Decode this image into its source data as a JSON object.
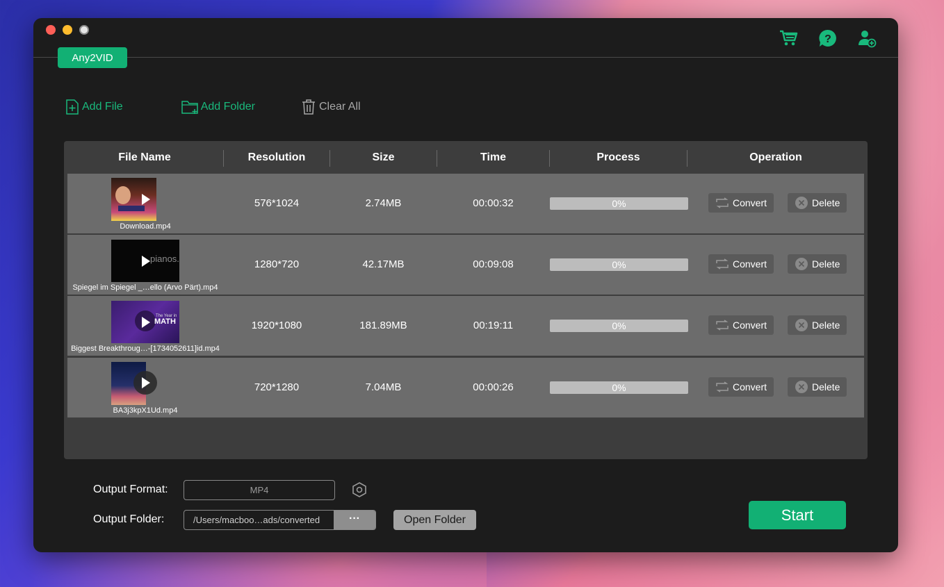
{
  "app": {
    "brand_tab": "Any2VID",
    "accent_color": "#12b074"
  },
  "top_icons": [
    "cart-icon",
    "help-icon",
    "add-user-icon"
  ],
  "toolbar": {
    "add_file": "Add File",
    "add_folder": "Add Folder",
    "clear_all": "Clear All"
  },
  "table": {
    "headers": [
      "File Name",
      "Resolution",
      "Size",
      "Time",
      "Process",
      "Operation"
    ],
    "rows": [
      {
        "filename": "Download.mp4",
        "resolution": "576*1024",
        "size": "2.74MB",
        "time": "00:00:32",
        "process": "0%",
        "convert": "Convert",
        "delete": "Delete"
      },
      {
        "filename": "Spiegel im Spiegel _…ello (Arvo Pärt).mp4",
        "resolution": "1280*720",
        "size": "42.17MB",
        "time": "00:09:08",
        "process": "0%",
        "convert": "Convert",
        "delete": "Delete",
        "thumb_text": "pianos."
      },
      {
        "filename": "Biggest Breakthroug…-[1734052611]id.mp4",
        "resolution": "1920*1080",
        "size": "181.89MB",
        "time": "00:19:11",
        "process": "0%",
        "convert": "Convert",
        "delete": "Delete",
        "thumb_text": "MATH",
        "thumb_small": "The Year in"
      },
      {
        "filename": "BA3j3kpX1Ud.mp4",
        "resolution": "720*1280",
        "size": "7.04MB",
        "time": "00:00:26",
        "process": "0%",
        "convert": "Convert",
        "delete": "Delete"
      }
    ]
  },
  "output": {
    "format_label": "Output Format:",
    "format_value": "MP4",
    "folder_label": "Output Folder:",
    "folder_value": "/Users/macboo…ads/converted",
    "folder_browse": "···",
    "open_folder": "Open Folder"
  },
  "start": "Start"
}
